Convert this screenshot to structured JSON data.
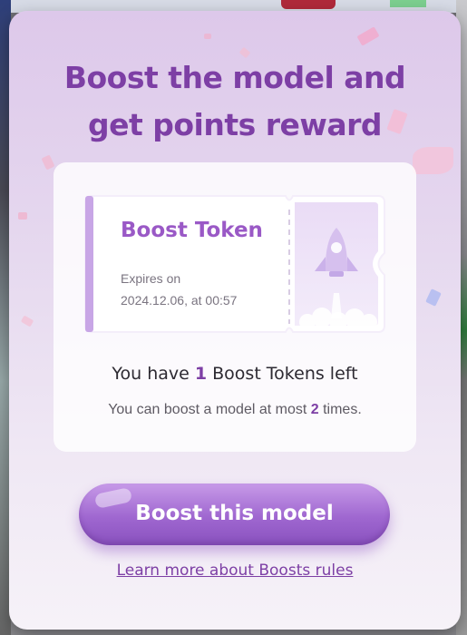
{
  "modal": {
    "title_line1": "Boost the model and",
    "title_line2": "get points reward"
  },
  "ticket": {
    "name": "Boost Token",
    "expires_label": "Expires on",
    "expires_value": "2024.12.06, at 00:57",
    "icon": "rocket-icon"
  },
  "tokens": {
    "prefix": "You have ",
    "count": "1",
    "suffix": " Boost Tokens left"
  },
  "limit": {
    "prefix": "You can boost a model at most ",
    "count": "2",
    "suffix": " times."
  },
  "actions": {
    "boost_label": "Boost this model",
    "learn_more_label": "Learn more about Boosts rules"
  },
  "colors": {
    "accent": "#7d3fa5",
    "button": "#9f67d0",
    "ticket_accent": "#c8a6e6"
  }
}
